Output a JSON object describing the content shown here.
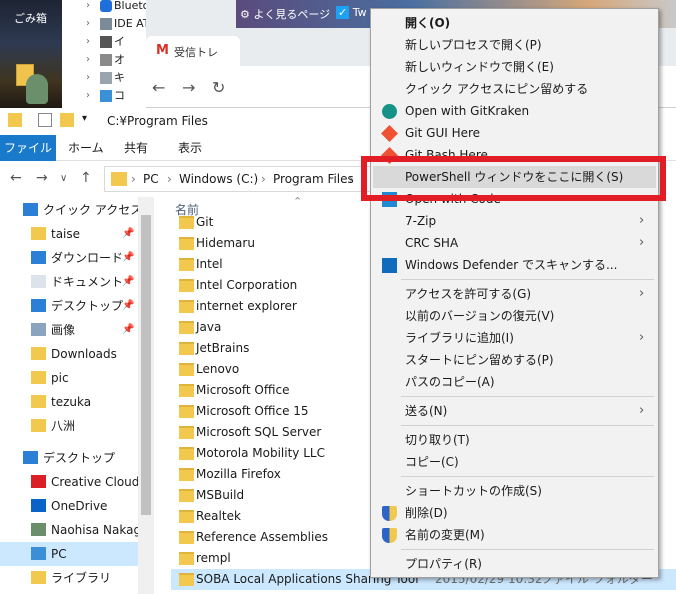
{
  "desktop": {
    "recycle_label": "ごみ箱"
  },
  "device_manager": {
    "items": [
      {
        "label": "Bluetooth",
        "icon": "bluetooth-icon"
      },
      {
        "label": "IDE ATA/ATAPI コントロ",
        "icon": "ide-controller-icon"
      },
      {
        "label": "イ",
        "icon": "device-icon"
      },
      {
        "label": "オ",
        "icon": "audio-icon"
      },
      {
        "label": "キ",
        "icon": "keyboard-icon"
      },
      {
        "label": "コ",
        "icon": "computer-icon"
      }
    ]
  },
  "browser": {
    "bookmark_frequent": "よく見るページ",
    "bookmark_twitter": "Tw",
    "tab_title": "受信トレ",
    "gmail_mark": "M"
  },
  "explorer": {
    "title_path": "C:¥Program Files",
    "ribbon_tabs": [
      "ファイル",
      "ホーム",
      "共有",
      "表示"
    ],
    "breadcrumb": [
      "PC",
      "Windows (C:)",
      "Program Files"
    ],
    "column_name": "名前",
    "nav_items": [
      {
        "label": "クイック アクセス",
        "icon": "star-icon",
        "pinned": false
      },
      {
        "label": "taise",
        "icon": "folder-icon",
        "pinned": true
      },
      {
        "label": "ダウンロード",
        "icon": "download-icon",
        "pinned": true
      },
      {
        "label": "ドキュメント",
        "icon": "document-icon",
        "pinned": true
      },
      {
        "label": "デスクトップ",
        "icon": "desktop-icon",
        "pinned": true
      },
      {
        "label": "画像",
        "icon": "picture-icon",
        "pinned": true
      },
      {
        "label": "Downloads",
        "icon": "folder-icon",
        "pinned": false
      },
      {
        "label": "pic",
        "icon": "folder-icon",
        "pinned": false
      },
      {
        "label": "tezuka",
        "icon": "folder-icon",
        "pinned": false
      },
      {
        "label": "八洲",
        "icon": "folder-icon",
        "pinned": false
      },
      {
        "label": "デスクトップ",
        "icon": "desktop-icon",
        "pinned": false
      },
      {
        "label": "Creative Cloud F",
        "icon": "creative-cloud-icon",
        "pinned": false
      },
      {
        "label": "OneDrive",
        "icon": "onedrive-icon",
        "pinned": false
      },
      {
        "label": "Naohisa Nakaga",
        "icon": "user-icon",
        "pinned": false
      },
      {
        "label": "PC",
        "icon": "pc-icon",
        "pinned": false
      },
      {
        "label": "ライブラリ",
        "icon": "library-icon",
        "pinned": false
      }
    ],
    "files": [
      "Git",
      "Hidemaru",
      "Intel",
      "Intel Corporation",
      "internet explorer",
      "Java",
      "JetBrains",
      "Lenovo",
      "Microsoft Office",
      "Microsoft Office 15",
      "Microsoft SQL Server",
      "Motorola Mobility LLC",
      "Mozilla Firefox",
      "MSBuild",
      "Realtek",
      "Reference Assemblies",
      "rempl",
      "SOBA Local Applications Sharing Tool"
    ],
    "selected_file_date": "2015/02/29 10:32",
    "selected_file_type": "ファイル フォルダー"
  },
  "context_menu": {
    "items": [
      {
        "label": "開く(O)",
        "bold": true
      },
      {
        "label": "新しいプロセスで開く(P)"
      },
      {
        "label": "新しいウィンドウで開く(E)"
      },
      {
        "label": "クイック アクセスにピン留めする"
      },
      {
        "label": "Open with GitKraken",
        "icon": "gitkraken-icon"
      },
      {
        "label": "Git GUI Here",
        "icon": "git-icon"
      },
      {
        "label": "Git Bash Here",
        "icon": "git-icon"
      },
      {
        "label": "PowerShell ウィンドウをここに開く(S)",
        "hover": true
      },
      {
        "label": "Open with Code",
        "icon": "vscode-icon"
      },
      {
        "label": "7-Zip",
        "submenu": true
      },
      {
        "label": "CRC SHA",
        "submenu": true
      },
      {
        "label": "Windows Defender でスキャンする...",
        "icon": "defender-icon"
      },
      {
        "label": "アクセスを許可する(G)",
        "submenu": true
      },
      {
        "label": "以前のバージョンの復元(V)"
      },
      {
        "label": "ライブラリに追加(I)",
        "submenu": true
      },
      {
        "label": "スタートにピン留めする(P)"
      },
      {
        "label": "パスのコピー(A)"
      },
      {
        "label": "送る(N)",
        "submenu": true
      },
      {
        "label": "切り取り(T)"
      },
      {
        "label": "コピー(C)"
      },
      {
        "label": "ショートカットの作成(S)"
      },
      {
        "label": "削除(D)",
        "icon": "shield-icon"
      },
      {
        "label": "名前の変更(M)",
        "icon": "shield-icon"
      },
      {
        "label": "プロパティ(R)"
      }
    ]
  },
  "colors": {
    "accent": "#1979ca",
    "selection": "#cce8ff",
    "highlight_box": "#e21d26",
    "folder": "#f3c84f"
  }
}
